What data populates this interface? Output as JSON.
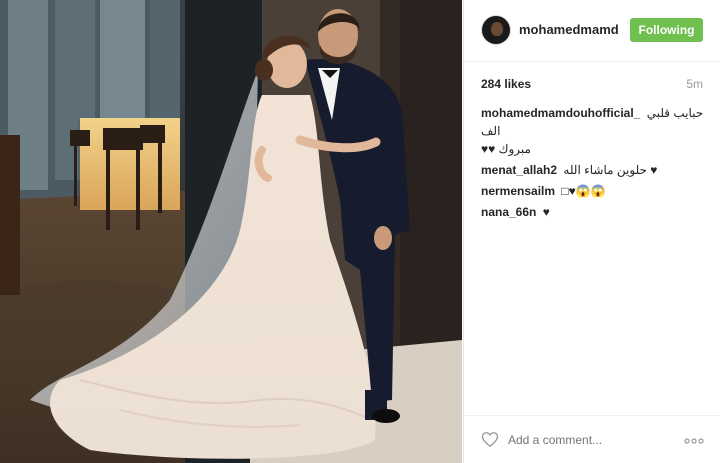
{
  "post": {
    "username": "mohamedmamd...",
    "follow_label": "Following",
    "likes": "284 likes",
    "time": "5m",
    "comments": [
      {
        "user": "mohamedmamdouhofficial_",
        "text": "حبايب قلبي الف",
        "line2": "مبروك ♥♥"
      },
      {
        "user": "menat_allah2",
        "text": "حلوين ماشاء الله ♥"
      },
      {
        "user": "nermensailm",
        "text": "□♥😱😱"
      },
      {
        "user": "nana_66n",
        "text": "♥"
      }
    ],
    "add_comment_placeholder": "Add a comment..."
  },
  "colors": {
    "follow_button": "#70c050",
    "text": "#262626",
    "muted": "#999999"
  },
  "icons": {
    "like": "heart-outline-icon",
    "more": "ellipsis-icon"
  }
}
